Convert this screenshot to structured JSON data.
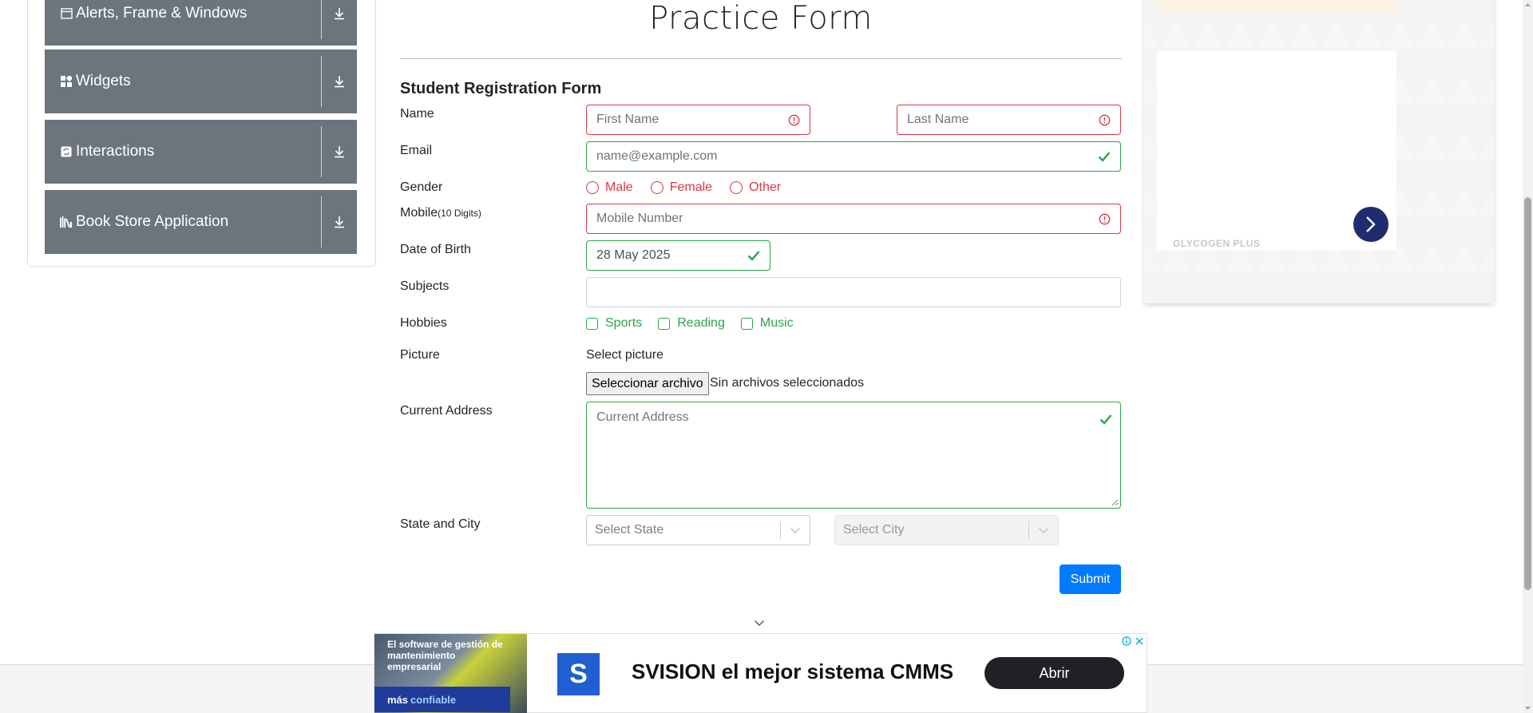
{
  "sidebar": {
    "groups": [
      {
        "label": "Alerts, Frame & Windows",
        "icon": "window-icon"
      },
      {
        "label": "Widgets",
        "icon": "widgets-icon"
      },
      {
        "label": "Interactions",
        "icon": "interactions-icon"
      },
      {
        "label": "Book Store Application",
        "icon": "books-icon"
      }
    ]
  },
  "form": {
    "title": "Practice Form",
    "subtitle": "Student Registration Form",
    "labels": {
      "name": "Name",
      "email": "Email",
      "gender": "Gender",
      "mobile": "Mobile",
      "mobile_hint": "(10 Digits)",
      "dob": "Date of Birth",
      "subjects": "Subjects",
      "hobbies": "Hobbies",
      "picture": "Picture",
      "address": "Current Address",
      "state_city": "State and City"
    },
    "first_name_placeholder": "First Name",
    "last_name_placeholder": "Last Name",
    "email_placeholder": "name@example.com",
    "gender_options": [
      "Male",
      "Female",
      "Other"
    ],
    "mobile_placeholder": "Mobile Number",
    "dob_value": "28 May 2025",
    "subjects_value": "",
    "hobby_options": [
      "Sports",
      "Reading",
      "Music"
    ],
    "picture_prompt": "Select picture",
    "file_button": "Seleccionar archivo",
    "file_status": "Sin archivos seleccionados",
    "address_placeholder": "Current Address",
    "state_placeholder": "Select State",
    "city_placeholder": "Select City",
    "submit_label": "Submit",
    "colors": {
      "invalid": "#dc3545",
      "valid": "#28a745",
      "primary": "#007bff"
    }
  },
  "right_ad": {
    "brand": "GLYCOGEN PLUS"
  },
  "bottom_ad": {
    "image_text": "El software de gestión de mantenimiento empresarial",
    "image_tag_1": "más",
    "image_tag_2": "confiable",
    "logo_letter": "S",
    "headline": "SVISION el mejor sistema CMMS",
    "cta": "Abrir"
  }
}
